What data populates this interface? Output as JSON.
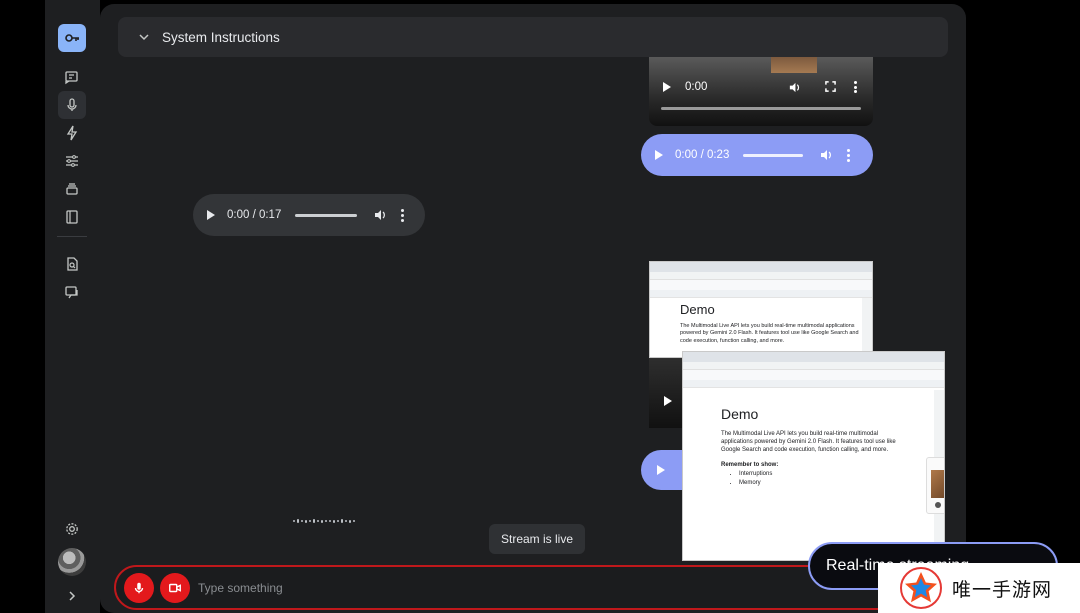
{
  "system_instructions": {
    "label": "System Instructions"
  },
  "audio_left": {
    "time": "0:00 / 0:17"
  },
  "audio_right": {
    "time": "0:00 / 0:23"
  },
  "video_top": {
    "time": "0:00"
  },
  "doc_back": {
    "title": "Demo",
    "body": "The Multimodal Live API lets you build real-time multimodal applications powered by Gemini 2.0 Flash. It features tool use like Google Search and code execution, function calling, and more."
  },
  "doc_front": {
    "title": "Demo",
    "body": "The Multimodal Live API lets you build real-time multimodal applications powered by Gemini 2.0 Flash. It features tool use like Google Search and code execution, function calling, and more.",
    "reminder": "Remember to show:",
    "items": [
      "Interruptions",
      "Memory"
    ]
  },
  "toast": {
    "text": "Stream is live"
  },
  "input": {
    "placeholder": "Type something"
  },
  "realtime_caption": {
    "text": "Real-time streaming"
  },
  "watermark": {
    "text": "唯一手游网"
  },
  "colors": {
    "accent": "#8c9cf5",
    "record_red": "#e3191c",
    "panel": "#1e1f21"
  }
}
